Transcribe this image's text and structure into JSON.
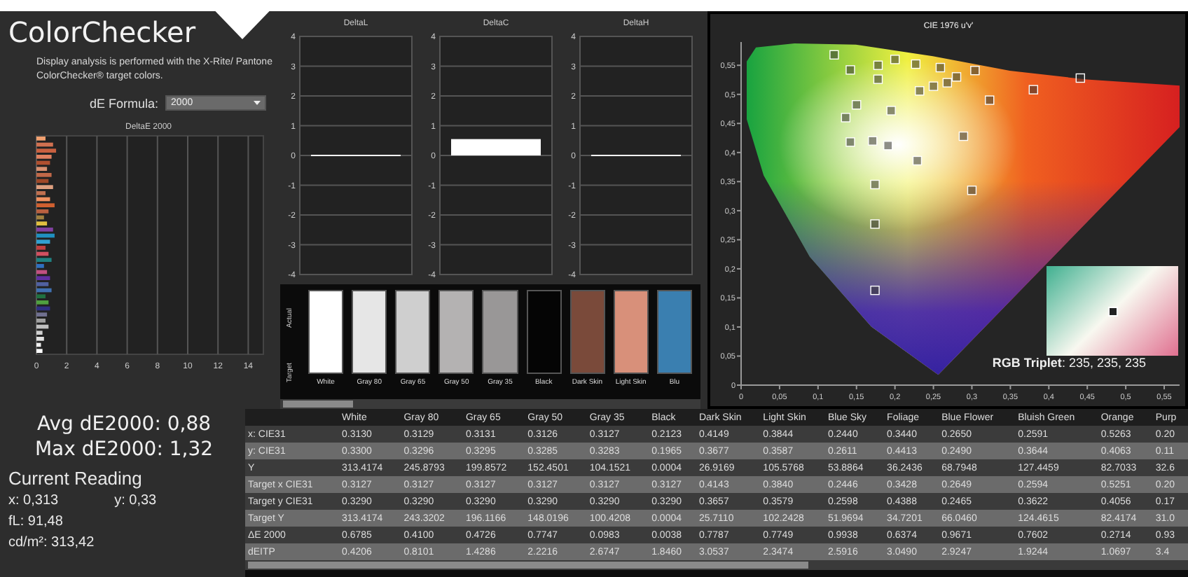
{
  "title": "ColorChecker",
  "description": "Display analysis is performed with the X-Rite/ Pantone ColorChecker® target colors.",
  "formula": {
    "label": "dE Formula:",
    "value": "2000"
  },
  "delta_e_chart": {
    "chart_data": {
      "type": "bar",
      "orientation": "horizontal",
      "title": "DeltaE 2000",
      "grid": true,
      "xlim": [
        0,
        15
      ],
      "xticks": [
        0,
        2,
        4,
        6,
        8,
        10,
        12,
        14
      ],
      "series": [
        {
          "color": "#f0a070",
          "values": [
            0.6
          ]
        },
        {
          "color": "#d07050",
          "values": [
            1.1
          ]
        },
        {
          "color": "#c86040",
          "values": [
            1.3
          ]
        },
        {
          "color": "#e08060",
          "values": [
            1.0
          ]
        },
        {
          "color": "#b05030",
          "values": [
            0.9
          ]
        },
        {
          "color": "#d89070",
          "values": [
            0.7
          ]
        },
        {
          "color": "#c06848",
          "values": [
            1.0
          ]
        },
        {
          "color": "#a04828",
          "values": [
            0.8
          ]
        },
        {
          "color": "#e0a080",
          "values": [
            1.1
          ]
        },
        {
          "color": "#c07050",
          "values": [
            0.6
          ]
        },
        {
          "color": "#f09060",
          "values": [
            0.9
          ]
        },
        {
          "color": "#d06030",
          "values": [
            1.2
          ]
        },
        {
          "color": "#b86040",
          "values": [
            0.8
          ]
        },
        {
          "color": "#a08040",
          "values": [
            0.5
          ]
        },
        {
          "color": "#e0c040",
          "values": [
            0.7
          ]
        },
        {
          "color": "#8040a0",
          "values": [
            1.1
          ]
        },
        {
          "color": "#2090c0",
          "values": [
            1.2
          ]
        },
        {
          "color": "#30a0d0",
          "values": [
            0.9
          ]
        },
        {
          "color": "#c04040",
          "values": [
            0.6
          ]
        },
        {
          "color": "#d05060",
          "values": [
            0.8
          ]
        },
        {
          "color": "#208080",
          "values": [
            1.0
          ]
        },
        {
          "color": "#3070c0",
          "values": [
            0.5
          ]
        },
        {
          "color": "#c05080",
          "values": [
            0.7
          ]
        },
        {
          "color": "#6030a0",
          "values": [
            0.9
          ]
        },
        {
          "color": "#5060a0",
          "values": [
            0.8
          ]
        },
        {
          "color": "#4070b0",
          "values": [
            1.0
          ]
        },
        {
          "color": "#207040",
          "values": [
            0.6
          ]
        },
        {
          "color": "#50a040",
          "values": [
            0.8
          ]
        },
        {
          "color": "#303080",
          "values": [
            0.9
          ]
        },
        {
          "color": "#707090",
          "values": [
            0.7
          ]
        },
        {
          "color": "#a0a0a0",
          "values": [
            0.6
          ]
        },
        {
          "color": "#c0c0c0",
          "values": [
            0.8
          ]
        },
        {
          "color": "#d0d0d0",
          "values": [
            0.4
          ]
        },
        {
          "color": "#e0e0e0",
          "values": [
            0.5
          ]
        },
        {
          "color": "#f0f0f0",
          "values": [
            0.3
          ]
        },
        {
          "color": "#ffffff",
          "values": [
            0.4
          ]
        }
      ]
    }
  },
  "stats": [
    {
      "text": "Avg dE2000: 0,88"
    },
    {
      "text": "Max dE2000: 1,32"
    }
  ],
  "current_reading": {
    "title": "Current Reading",
    "x": "x: 0,313",
    "y": "y: 0,33",
    "fl": "fL: 91,48",
    "cdm2": "cd/m²: 313,42"
  },
  "delta_charts": [
    {
      "chart_data": {
        "type": "bar",
        "title": "DeltaL",
        "grid": true,
        "ylim": [
          -4,
          4
        ],
        "yticks": [
          4,
          3,
          2,
          1,
          0,
          -1,
          -2,
          -3,
          -4
        ],
        "series": [
          {
            "color": "#ffffff",
            "values": [
              0
            ]
          }
        ]
      }
    },
    {
      "chart_data": {
        "type": "bar",
        "title": "DeltaC",
        "grid": true,
        "ylim": [
          -4,
          4
        ],
        "yticks": [
          4,
          3,
          2,
          1,
          0,
          -1,
          -2,
          -3,
          -4
        ],
        "series": [
          {
            "color": "#ffffff",
            "values": [
              0.55
            ]
          }
        ]
      }
    },
    {
      "chart_data": {
        "type": "bar",
        "title": "DeltaH",
        "grid": true,
        "ylim": [
          -4,
          4
        ],
        "yticks": [
          4,
          3,
          2,
          1,
          0,
          -1,
          -2,
          -3,
          -4
        ],
        "series": [
          {
            "color": "#ffffff",
            "values": [
              0
            ]
          }
        ]
      }
    }
  ],
  "swatch_side_labels": [
    "Actual",
    "Target"
  ],
  "swatches": [
    {
      "label": "White",
      "color": "#ffffff"
    },
    {
      "label": "Gray 80",
      "color": "#e6e6e6"
    },
    {
      "label": "Gray 65",
      "color": "#cfcfcf"
    },
    {
      "label": "Gray 50",
      "color": "#b4b2b2"
    },
    {
      "label": "Gray 35",
      "color": "#999797"
    },
    {
      "label": "Black",
      "color": "#050505"
    },
    {
      "label": "Dark Skin",
      "color": "#7a4a3a"
    },
    {
      "label": "Light Skin",
      "color": "#d8907a"
    },
    {
      "label": "Blu",
      "color": "#3a7fb0"
    }
  ],
  "cie_chart": {
    "chart_data": {
      "type": "scatter",
      "title": "CIE 1976 u'v'",
      "xlim": [
        0,
        0.57
      ],
      "ylim": [
        0,
        0.59
      ],
      "xticks": [
        {
          "value": 0,
          "label": "0"
        },
        {
          "value": 0.05,
          "label": "0,05"
        },
        {
          "value": 0.1,
          "label": "0,1"
        },
        {
          "value": 0.15,
          "label": "0,15"
        },
        {
          "value": 0.2,
          "label": "0,2"
        },
        {
          "value": 0.25,
          "label": "0,25"
        },
        {
          "value": 0.3,
          "label": "0,3"
        },
        {
          "value": 0.35,
          "label": "0,35"
        },
        {
          "value": 0.4,
          "label": "0,4"
        },
        {
          "value": 0.45,
          "label": "0,45"
        },
        {
          "value": 0.5,
          "label": "0,5"
        },
        {
          "value": 0.55,
          "label": "0,55"
        }
      ],
      "yticks": [
        {
          "value": 0,
          "label": "0"
        },
        {
          "value": 0.05,
          "label": "0,05"
        },
        {
          "value": 0.1,
          "label": "0,1"
        },
        {
          "value": 0.15,
          "label": "0,15"
        },
        {
          "value": 0.2,
          "label": "0,2"
        },
        {
          "value": 0.25,
          "label": "0,25"
        },
        {
          "value": 0.3,
          "label": "0,3"
        },
        {
          "value": 0.35,
          "label": "0,35"
        },
        {
          "value": 0.4,
          "label": "0,4"
        },
        {
          "value": 0.45,
          "label": "0,45"
        },
        {
          "value": 0.5,
          "label": "0,5"
        },
        {
          "value": 0.55,
          "label": "0,55"
        }
      ],
      "series": [
        {
          "color": "#333333",
          "x": [
            0.121,
            0.142,
            0.178,
            0.178,
            0.2,
            0.227,
            0.259,
            0.304,
            0.232,
            0.25,
            0.268,
            0.28,
            0.38,
            0.441,
            0.15,
            0.323,
            0.195,
            0.136,
            0.142,
            0.171,
            0.191,
            0.289,
            0.229,
            0.174,
            0.3,
            0.174,
            0.174
          ],
          "values": [
            0.568,
            0.542,
            0.55,
            0.526,
            0.56,
            0.552,
            0.546,
            0.541,
            0.506,
            0.514,
            0.52,
            0.53,
            0.508,
            0.528,
            0.482,
            0.49,
            0.472,
            0.46,
            0.418,
            0.42,
            0.412,
            0.428,
            0.386,
            0.345,
            0.335,
            0.277,
            0.163
          ]
        }
      ]
    },
    "rgb_triplet": "**RGB Triplet**: 235, 235, 235"
  },
  "table": {
    "columns": [
      "White",
      "Gray 80",
      "Gray 65",
      "Gray 50",
      "Gray 35",
      "Black",
      "Dark Skin",
      "Light Skin",
      "Blue Sky",
      "Foliage",
      "Blue Flower",
      "Bluish Green",
      "Orange",
      "Purp"
    ],
    "rows": [
      {
        "label": "x: CIE31",
        "cells": [
          "0.3130",
          "0.3129",
          "0.3131",
          "0.3126",
          "0.3127",
          "0.2123",
          "0.4149",
          "0.3844",
          "0.2440",
          "0.3440",
          "0.2650",
          "0.2591",
          "0.5263",
          "0.20"
        ]
      },
      {
        "label": "y: CIE31",
        "cells": [
          "0.3300",
          "0.3296",
          "0.3295",
          "0.3285",
          "0.3283",
          "0.1965",
          "0.3677",
          "0.3587",
          "0.2611",
          "0.4413",
          "0.2490",
          "0.3644",
          "0.4063",
          "0.11"
        ]
      },
      {
        "label": "Y",
        "cells": [
          "313.4174",
          "245.8793",
          "199.8572",
          "152.4501",
          "104.1521",
          "0.0004",
          "26.9169",
          "105.5768",
          "53.8864",
          "36.2436",
          "68.7948",
          "127.4459",
          "82.7033",
          "32.6"
        ]
      },
      {
        "label": "Target x CIE31",
        "cells": [
          "0.3127",
          "0.3127",
          "0.3127",
          "0.3127",
          "0.3127",
          "0.3127",
          "0.4143",
          "0.3840",
          "0.2446",
          "0.3428",
          "0.2649",
          "0.2594",
          "0.5251",
          "0.20"
        ]
      },
      {
        "label": "Target y CIE31",
        "cells": [
          "0.3290",
          "0.3290",
          "0.3290",
          "0.3290",
          "0.3290",
          "0.3290",
          "0.3657",
          "0.3579",
          "0.2598",
          "0.4388",
          "0.2465",
          "0.3622",
          "0.4056",
          "0.17"
        ]
      },
      {
        "label": "Target Y",
        "cells": [
          "313.4174",
          "243.3202",
          "196.1166",
          "148.0196",
          "100.4208",
          "0.0004",
          "25.7110",
          "102.2428",
          "51.9694",
          "34.7201",
          "66.0460",
          "124.4615",
          "82.4174",
          "31.0"
        ]
      },
      {
        "label": "ΔE 2000",
        "cells": [
          "0.6785",
          "0.4100",
          "0.4726",
          "0.7747",
          "0.0983",
          "0.0038",
          "0.7787",
          "0.7749",
          "0.9938",
          "0.6374",
          "0.9671",
          "0.7602",
          "0.2714",
          "0.93"
        ]
      },
      {
        "label": "dEITP",
        "cells": [
          "0.4206",
          "0.8101",
          "1.4286",
          "2.2216",
          "2.6747",
          "1.8460",
          "3.0537",
          "2.3474",
          "2.5916",
          "3.0490",
          "2.9247",
          "1.9244",
          "1.0697",
          "3.4"
        ]
      }
    ]
  }
}
